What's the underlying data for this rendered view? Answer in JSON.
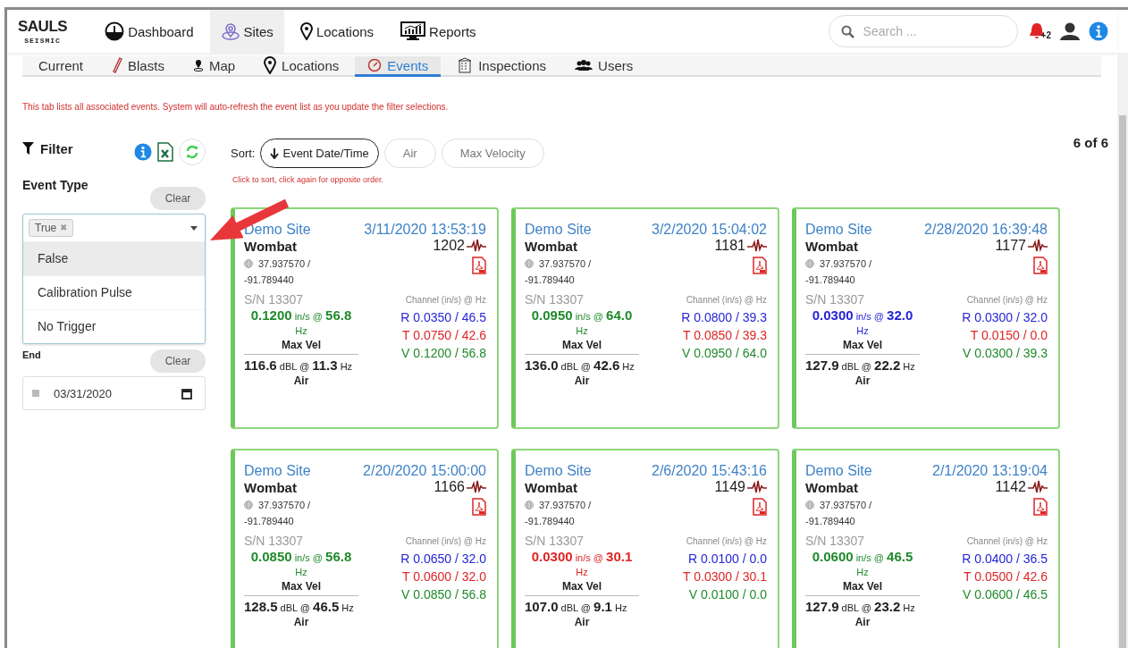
{
  "nav": {
    "logo": "SAULS",
    "logo_sub": "SEISMIC",
    "items": [
      {
        "label": "Dashboard",
        "selected": false
      },
      {
        "label": "Sites",
        "selected": true
      },
      {
        "label": "Locations",
        "selected": false
      },
      {
        "label": "Reports",
        "selected": false
      }
    ],
    "search": {
      "placeholder": "Search ..."
    },
    "notification_count": "+2"
  },
  "subtabs": [
    {
      "label": "Current",
      "selected": false
    },
    {
      "label": "Blasts",
      "selected": false
    },
    {
      "label": "Map",
      "selected": false
    },
    {
      "label": "Locations",
      "selected": false
    },
    {
      "label": "Events",
      "selected": true
    },
    {
      "label": "Inspections",
      "selected": false
    },
    {
      "label": "Users",
      "selected": false
    }
  ],
  "notice": "This tab lists all associated events. System will auto-refresh the event list as you update the filter selections.",
  "filter": {
    "title": "Filter",
    "event_type": {
      "label": "Event Type",
      "clear": "Clear",
      "tags": [
        {
          "label": "True",
          "remove": "✖"
        }
      ],
      "options": [
        {
          "label": "False",
          "highlighted": true
        },
        {
          "label": "Calibration Pulse",
          "highlighted": false
        },
        {
          "label": "No Trigger",
          "highlighted": false
        }
      ]
    },
    "end": {
      "label": "End",
      "clear": "Clear",
      "value": "03/31/2020"
    }
  },
  "sort": {
    "label": "Sort:",
    "hint": "Click to sort, click again for opposite order.",
    "options": [
      {
        "label": "Event Date/Time",
        "selected": true
      },
      {
        "label": "Air",
        "selected": false
      },
      {
        "label": "Max Velocity",
        "selected": false
      }
    ]
  },
  "count": "6 of 6",
  "events": [
    {
      "site": "Demo Site",
      "datetime": "3/11/2020 13:53:19",
      "name": "Wombat",
      "event_id": "1202",
      "lat": "37.937570 /",
      "lon": "-91.789440",
      "serial": "S/N 13307",
      "channel_header": "Channel (in/s) @ Hz",
      "max_vel": {
        "text": "**0.1200** in/s @ **56.8** Hz",
        "color": "#1f8a2a"
      },
      "max_label": "Max Vel",
      "channels": [
        {
          "reading": "R 0.0350 / 46.5",
          "color": "#2424d8"
        },
        {
          "reading": "T 0.0750 / 42.6",
          "color": "#e02424"
        },
        {
          "reading": "V 0.1200 / 56.8",
          "color": "#1f8a2a"
        }
      ],
      "air": "**116.6** dBL @ **11.3** Hz",
      "air_label": "Air"
    },
    {
      "site": "Demo Site",
      "datetime": "3/2/2020 15:04:02",
      "name": "Wombat",
      "event_id": "1181",
      "lat": "37.937570 /",
      "lon": "-91.789440",
      "serial": "S/N 13307",
      "channel_header": "Channel (in/s) @ Hz",
      "max_vel": {
        "text": "**0.0950** in/s @ **64.0** Hz",
        "color": "#1f8a2a"
      },
      "max_label": "Max Vel",
      "channels": [
        {
          "reading": "R 0.0800 / 39.3",
          "color": "#2424d8"
        },
        {
          "reading": "T 0.0850 / 39.3",
          "color": "#e02424"
        },
        {
          "reading": "V 0.0950 / 64.0",
          "color": "#1f8a2a"
        }
      ],
      "air": "**136.0** dBL @ **42.6** Hz",
      "air_label": "Air"
    },
    {
      "site": "Demo Site",
      "datetime": "2/28/2020 16:39:48",
      "name": "Wombat",
      "event_id": "1177",
      "lat": "37.937570 /",
      "lon": "-91.789440",
      "serial": "S/N 13307",
      "channel_header": "Channel (in/s) @ Hz",
      "max_vel": {
        "text": "**0.0300** in/s @ **32.0** Hz",
        "color": "#2424d8"
      },
      "max_label": "Max Vel",
      "channels": [
        {
          "reading": "R 0.0300 / 32.0",
          "color": "#2424d8"
        },
        {
          "reading": "T 0.0150 / 0.0",
          "color": "#e02424"
        },
        {
          "reading": "V 0.0300 / 39.3",
          "color": "#1f8a2a"
        }
      ],
      "air": "**127.9** dBL @ **22.2** Hz",
      "air_label": "Air"
    },
    {
      "site": "Demo Site",
      "datetime": "2/20/2020 15:00:00",
      "name": "Wombat",
      "event_id": "1166",
      "lat": "37.937570 /",
      "lon": "-91.789440",
      "serial": "S/N 13307",
      "channel_header": "Channel (in/s) @ Hz",
      "max_vel": {
        "text": "**0.0850** in/s @ **56.8** Hz",
        "color": "#1f8a2a"
      },
      "max_label": "Max Vel",
      "channels": [
        {
          "reading": "R 0.0650 / 32.0",
          "color": "#2424d8"
        },
        {
          "reading": "T 0.0600 / 32.0",
          "color": "#e02424"
        },
        {
          "reading": "V 0.0850 / 56.8",
          "color": "#1f8a2a"
        }
      ],
      "air": "**128.5** dBL @ **46.5** Hz",
      "air_label": "Air"
    },
    {
      "site": "Demo Site",
      "datetime": "2/6/2020 15:43:16",
      "name": "Wombat",
      "event_id": "1149",
      "lat": "37.937570 /",
      "lon": "-91.789440",
      "serial": "S/N 13307",
      "channel_header": "Channel (in/s) @ Hz",
      "max_vel": {
        "text": "**0.0300** in/s @ **30.1** Hz",
        "color": "#e02424"
      },
      "max_label": "Max Vel",
      "channels": [
        {
          "reading": "R 0.0100 / 0.0",
          "color": "#2424d8"
        },
        {
          "reading": "T 0.0300 / 30.1",
          "color": "#e02424"
        },
        {
          "reading": "V 0.0100 / 0.0",
          "color": "#1f8a2a"
        }
      ],
      "air": "**107.0** dBL @ **9.1** Hz",
      "air_label": "Air"
    },
    {
      "site": "Demo Site",
      "datetime": "2/1/2020 13:19:04",
      "name": "Wombat",
      "event_id": "1142",
      "lat": "37.937570 /",
      "lon": "-91.789440",
      "serial": "S/N 13307",
      "channel_header": "Channel (in/s) @ Hz",
      "max_vel": {
        "text": "**0.0600** in/s @ **46.5** Hz",
        "color": "#1f8a2a"
      },
      "max_label": "Max Vel",
      "channels": [
        {
          "reading": "R 0.0400 / 36.5",
          "color": "#2424d8"
        },
        {
          "reading": "T 0.0500 / 42.6",
          "color": "#e02424"
        },
        {
          "reading": "V 0.0600 / 46.5",
          "color": "#1f8a2a"
        }
      ],
      "air": "**127.9** dBL @ **23.2** Hz",
      "air_label": "Air"
    }
  ]
}
